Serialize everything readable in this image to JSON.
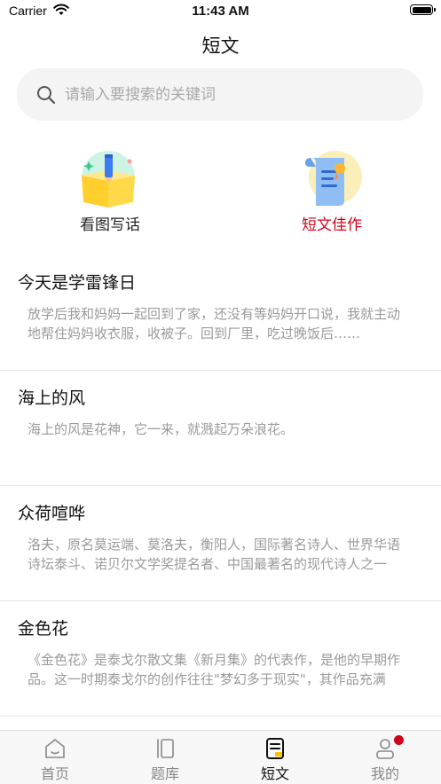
{
  "status": {
    "carrier": "Carrier",
    "time": "11:43 AM"
  },
  "header": {
    "title": "短文"
  },
  "search": {
    "placeholder": "请输入要搜索的关键词"
  },
  "categories": [
    {
      "label": "看图写话",
      "icon": "book-pencil-icon"
    },
    {
      "label": "短文佳作",
      "icon": "scroll-medal-icon"
    }
  ],
  "articles": [
    {
      "title": "今天是学雷锋日",
      "excerpt": "放学后我和妈妈一起回到了家，还没有等妈妈开口说，我就主动地帮住妈妈收衣服，收被子。回到厂里，吃过晚饭后……"
    },
    {
      "title": "海上的风",
      "excerpt": "海上的风是花神，它一来，就溅起万朵浪花。"
    },
    {
      "title": "众荷喧哗",
      "excerpt": "洛夫，原名莫运端、莫洛夫，衡阳人，国际著名诗人、世界华语诗坛泰斗、诺贝尔文学奖提名者、中国最著名的现代诗人之一"
    },
    {
      "title": "金色花",
      "excerpt": "《金色花》是泰戈尔散文集《新月集》的代表作，是他的早期作品。这一时期泰戈尔的创作往往\"梦幻多于现实\"，其作品充满"
    }
  ],
  "tabs": [
    {
      "label": "首页",
      "icon": "home-icon"
    },
    {
      "label": "题库",
      "icon": "question-bank-icon"
    },
    {
      "label": "短文",
      "icon": "document-icon"
    },
    {
      "label": "我的",
      "icon": "user-icon"
    }
  ],
  "colors": {
    "accent": "#d0021b",
    "text": "#111111",
    "muted": "#9a9a9a"
  }
}
